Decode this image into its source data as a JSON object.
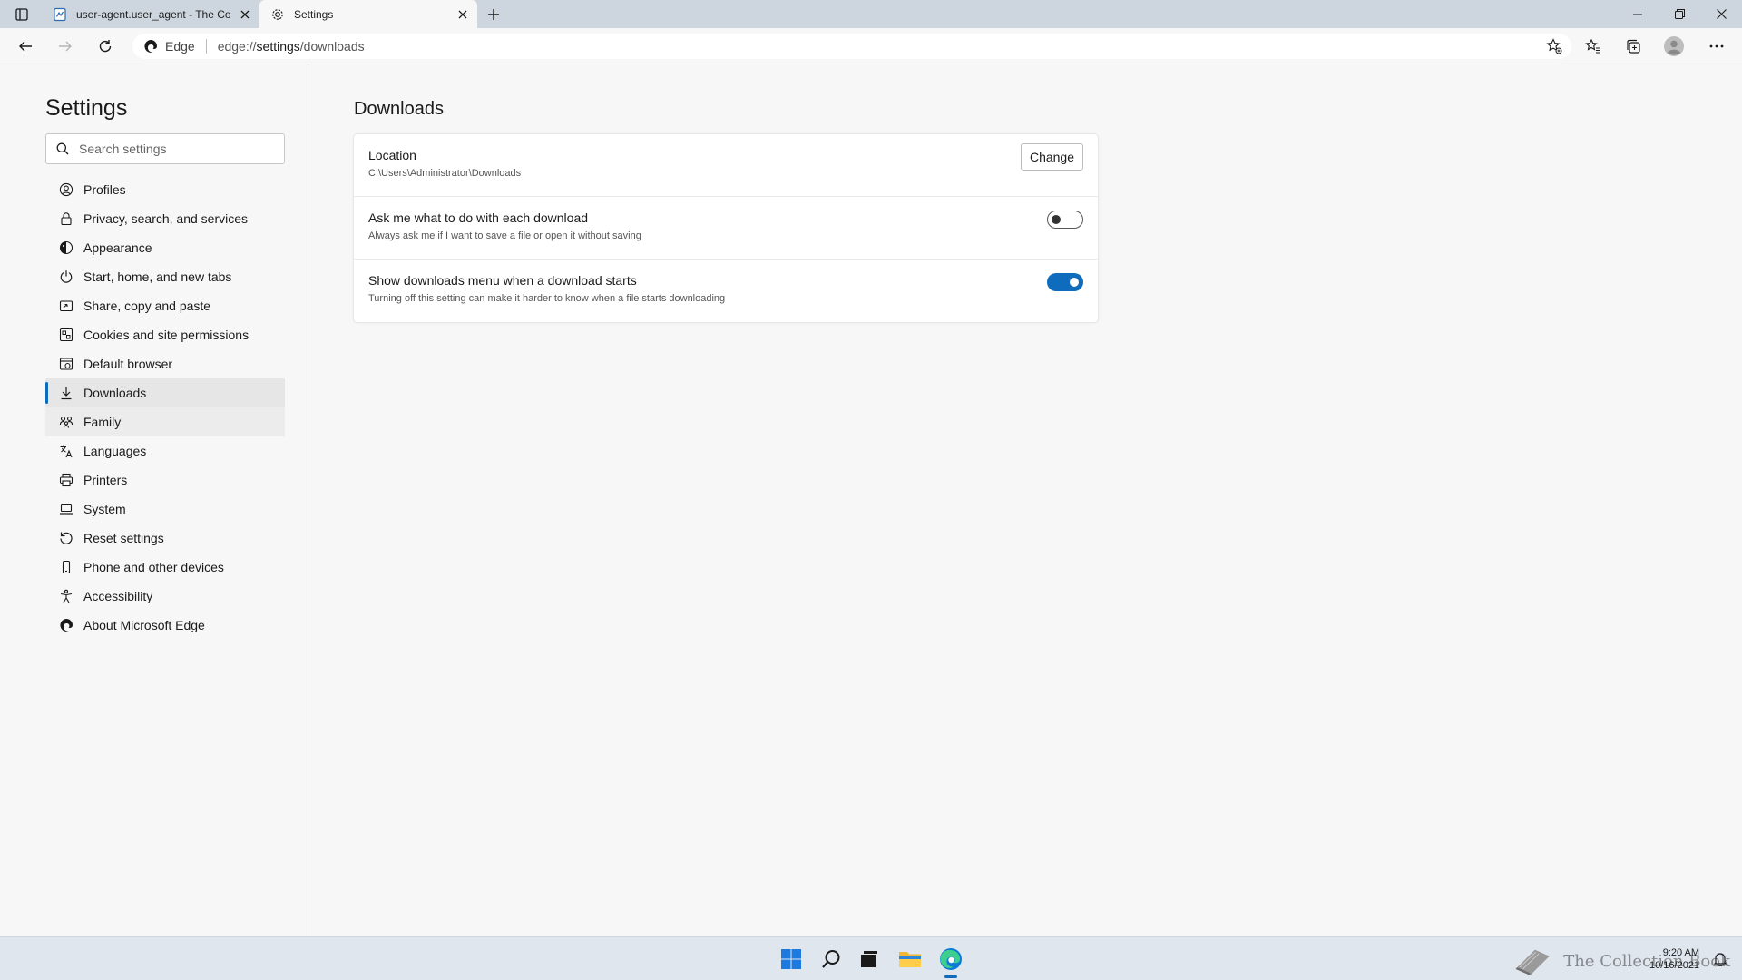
{
  "browser": {
    "tabs": [
      {
        "title": "user-agent.user_agent - The Coll",
        "favicon": "document-icon",
        "active": false
      },
      {
        "title": "Settings",
        "favicon": "gear-icon",
        "active": true
      }
    ],
    "address_bar": {
      "site_label": "Edge",
      "url_prefix": "edge://",
      "url_host": "settings",
      "url_path": "/downloads"
    }
  },
  "sidebar": {
    "title": "Settings",
    "search_placeholder": "Search settings",
    "items": [
      {
        "label": "Profiles",
        "icon": "profile-icon"
      },
      {
        "label": "Privacy, search, and services",
        "icon": "lock-icon"
      },
      {
        "label": "Appearance",
        "icon": "appearance-icon"
      },
      {
        "label": "Start, home, and new tabs",
        "icon": "power-icon"
      },
      {
        "label": "Share, copy and paste",
        "icon": "share-icon"
      },
      {
        "label": "Cookies and site permissions",
        "icon": "cookies-icon"
      },
      {
        "label": "Default browser",
        "icon": "browser-icon"
      },
      {
        "label": "Downloads",
        "icon": "download-icon",
        "active": true
      },
      {
        "label": "Family",
        "icon": "family-icon"
      },
      {
        "label": "Languages",
        "icon": "languages-icon"
      },
      {
        "label": "Printers",
        "icon": "printer-icon"
      },
      {
        "label": "System",
        "icon": "system-icon"
      },
      {
        "label": "Reset settings",
        "icon": "reset-icon"
      },
      {
        "label": "Phone and other devices",
        "icon": "phone-icon"
      },
      {
        "label": "Accessibility",
        "icon": "accessibility-icon"
      },
      {
        "label": "About Microsoft Edge",
        "icon": "edge-icon"
      }
    ]
  },
  "main": {
    "title": "Downloads",
    "location": {
      "title": "Location",
      "path": "C:\\Users\\Administrator\\Downloads",
      "button": "Change"
    },
    "ask_each_download": {
      "title": "Ask me what to do with each download",
      "description": "Always ask me if I want to save a file or open it without saving",
      "enabled": false
    },
    "show_menu": {
      "title": "Show downloads menu when a download starts",
      "description": "Turning off this setting can make it harder to know when a file starts downloading",
      "enabled": true
    }
  },
  "taskbar": {
    "time": "9:20 AM",
    "date": "10/16/2021",
    "watermark": "The Collection Book",
    "accent": "#0f6cbd"
  }
}
